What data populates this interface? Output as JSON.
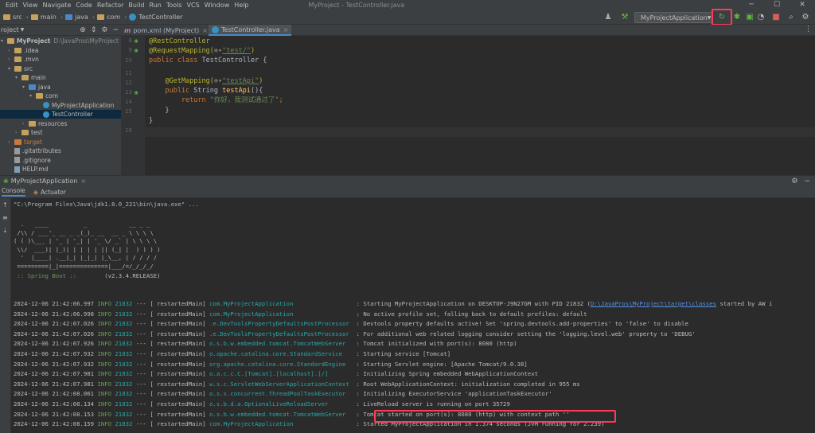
{
  "menubar": {
    "items": [
      "Edit",
      "View",
      "Navigate",
      "Code",
      "Refactor",
      "Build",
      "Run",
      "Tools",
      "VCS",
      "Window",
      "Help"
    ],
    "title": "MyProject - TestController.java"
  },
  "navbar": {
    "crumbs": [
      "src",
      "main",
      "java",
      "com",
      "TestController"
    ],
    "run_config": "MyProjectApplication"
  },
  "project": {
    "header": "roject",
    "tree": [
      {
        "label": "MyProject",
        "extra": "D:\\JavaPros\\MyProject",
        "indent": 0,
        "arrow": "▾",
        "icon": "folder",
        "bold": true
      },
      {
        "label": ".idea",
        "indent": 1,
        "arrow": "›",
        "icon": "folder"
      },
      {
        "label": ".mvn",
        "indent": 1,
        "arrow": "›",
        "icon": "folder"
      },
      {
        "label": "src",
        "indent": 1,
        "arrow": "▾",
        "icon": "folder"
      },
      {
        "label": "main",
        "indent": 2,
        "arrow": "▾",
        "icon": "folder"
      },
      {
        "label": "java",
        "indent": 3,
        "arrow": "▾",
        "icon": "folder-blue"
      },
      {
        "label": "com",
        "indent": 4,
        "arrow": "▾",
        "icon": "folder"
      },
      {
        "label": "MyProjectApplication",
        "indent": 5,
        "arrow": "",
        "icon": "class"
      },
      {
        "label": "TestController",
        "indent": 5,
        "arrow": "",
        "icon": "class",
        "selected": true
      },
      {
        "label": "resources",
        "indent": 3,
        "arrow": "›",
        "icon": "folder"
      },
      {
        "label": "test",
        "indent": 2,
        "arrow": "›",
        "icon": "folder"
      },
      {
        "label": "target",
        "indent": 1,
        "arrow": "›",
        "icon": "folder-orange"
      },
      {
        "label": ".gitattributes",
        "indent": 1,
        "arrow": "",
        "icon": "file"
      },
      {
        "label": ".gitignore",
        "indent": 1,
        "arrow": "",
        "icon": "file"
      },
      {
        "label": "HELP.md",
        "indent": 1,
        "arrow": "",
        "icon": "md"
      }
    ]
  },
  "editor": {
    "tabs": [
      "pom.xml (MyProject)",
      "TestController.java"
    ],
    "line_numbers": [
      "8",
      "9",
      "10",
      "11",
      "12",
      "13",
      "14",
      "15",
      "16"
    ],
    "code": {
      "l8": "@RestController",
      "l9a": "@RequestMapping(",
      "l9b": "\"test/\"",
      "l9c": ")",
      "l10a": "public class ",
      "l10b": "TestController {",
      "l12a": "    @GetMapping(",
      "l12b": "\"testApi\"",
      "l12c": ")",
      "l13a": "    public ",
      "l13b": "String ",
      "l13c": "testApi",
      "l13d": "(){",
      "l14a": "        return ",
      "l14b": "\"你好，我测试通过了\"",
      "l14c": ";",
      "l15": "    }",
      "l16": "}"
    }
  },
  "run": {
    "tab": "MyProjectApplication",
    "subtabs": [
      "Console",
      "Actuator"
    ],
    "cmd": "\"C:\\Program Files\\Java\\jdk1.8.0_221\\bin\\java.exe\" ...",
    "banner": [
      "  .   ____          _            __ _ _",
      " /\\\\ / ___'_ __ _ _(_)_ __  __ _ \\ \\ \\ \\",
      "( ( )\\___ | '_ | '_| | '_ \\/ _` | \\ \\ \\ \\",
      " \\\\/  ___)| |_)| | | | | || (_| |  ) ) ) )",
      "  '  |____| .__|_| |_|_| |_\\__, | / / / /",
      " =========|_|==============|___/=/_/_/_/"
    ],
    "spring_label": " :: Spring Boot ::",
    "spring_version": "(v2.3.4.RELEASE)",
    "logs": [
      {
        "ts": "2024-12-06 21:42:06.997",
        "lvl": "INFO",
        "pid": "21832",
        "thr": "restartedMain",
        "logger": "com.MyProjectApplication",
        "msg": ": Starting MyProjectApplication on DESKTOP-J9N27GM with PID 21832 (",
        "link": "D:\\JavaPros\\MyProject\\target\\classes",
        "tail": " started by AW i"
      },
      {
        "ts": "2024-12-06 21:42:06.998",
        "lvl": "INFO",
        "pid": "21832",
        "thr": "restartedMain",
        "logger": "com.MyProjectApplication",
        "msg": ": No active profile set, falling back to default profiles: default"
      },
      {
        "ts": "2024-12-06 21:42:07.026",
        "lvl": "INFO",
        "pid": "21832",
        "thr": "restartedMain",
        "logger": ".e.DevToolsPropertyDefaultsPostProcessor",
        "msg": ": Devtools property defaults active! Set 'spring.devtools.add-properties' to 'false' to disable"
      },
      {
        "ts": "2024-12-06 21:42:07.026",
        "lvl": "INFO",
        "pid": "21832",
        "thr": "restartedMain",
        "logger": ".e.DevToolsPropertyDefaultsPostProcessor",
        "msg": ": For additional web related logging consider setting the 'logging.level.web' property to 'DEBUG'"
      },
      {
        "ts": "2024-12-06 21:42:07.926",
        "lvl": "INFO",
        "pid": "21832",
        "thr": "restartedMain",
        "logger": "o.s.b.w.embedded.tomcat.TomcatWebServer",
        "msg": ": Tomcat initialized with port(s): 8080 (http)"
      },
      {
        "ts": "2024-12-06 21:42:07.932",
        "lvl": "INFO",
        "pid": "21832",
        "thr": "restartedMain",
        "logger": "o.apache.catalina.core.StandardService",
        "msg": ": Starting service [Tomcat]"
      },
      {
        "ts": "2024-12-06 21:42:07.932",
        "lvl": "INFO",
        "pid": "21832",
        "thr": "restartedMain",
        "logger": "org.apache.catalina.core.StandardEngine",
        "msg": ": Starting Servlet engine: [Apache Tomcat/9.0.38]"
      },
      {
        "ts": "2024-12-06 21:42:07.981",
        "lvl": "INFO",
        "pid": "21832",
        "thr": "restartedMain",
        "logger": "o.a.c.c.C.[Tomcat].[localhost].[/]",
        "msg": ": Initializing Spring embedded WebApplicationContext"
      },
      {
        "ts": "2024-12-06 21:42:07.981",
        "lvl": "INFO",
        "pid": "21832",
        "thr": "restartedMain",
        "logger": "w.s.c.ServletWebServerApplicationContext",
        "msg": ": Root WebApplicationContext: initialization completed in 955 ms"
      },
      {
        "ts": "2024-12-06 21:42:08.061",
        "lvl": "INFO",
        "pid": "21832",
        "thr": "restartedMain",
        "logger": "o.s.s.concurrent.ThreadPoolTaskExecutor",
        "msg": ": Initializing ExecutorService 'applicationTaskExecutor'"
      },
      {
        "ts": "2024-12-06 21:42:08.134",
        "lvl": "INFO",
        "pid": "21832",
        "thr": "restartedMain",
        "logger": "o.s.b.d.a.OptionalLiveReloadServer",
        "msg": ": LiveReload server is running on port 35729"
      },
      {
        "ts": "2024-12-06 21:42:08.153",
        "lvl": "INFO",
        "pid": "21832",
        "thr": "restartedMain",
        "logger": "o.s.b.w.embedded.tomcat.TomcatWebServer",
        "msg": ": Tomcat started on port(s): 8080 (http) with context path ''"
      },
      {
        "ts": "2024-12-06 21:42:08.159",
        "lvl": "INFO",
        "pid": "21832",
        "thr": "restartedMain",
        "logger": "com.MyProjectApplication",
        "msg": ": Started MyProjectApplication in 1.374 seconds (JVM running for 2.239)"
      }
    ]
  },
  "colors": {
    "highlight": "#ff3b57",
    "accent": "#4a88c7"
  }
}
